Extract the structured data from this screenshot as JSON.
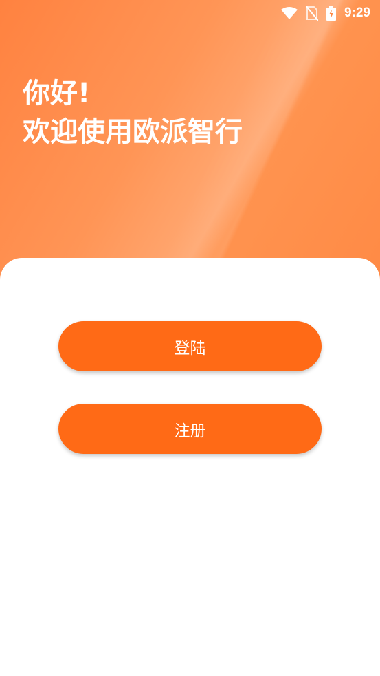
{
  "status_bar": {
    "time": "9:29",
    "icons": [
      "wifi-icon",
      "no-sim-icon",
      "battery-charging-icon"
    ]
  },
  "greeting": {
    "line1": "你好!",
    "line2": "欢迎使用欧派智行"
  },
  "actions": {
    "login_label": "登陆",
    "register_label": "注册"
  },
  "colors": {
    "accent": "#ff6a16",
    "header_gradient_start": "#ff8240",
    "header_gradient_mid": "#ffa872",
    "card_background": "#ffffff"
  }
}
